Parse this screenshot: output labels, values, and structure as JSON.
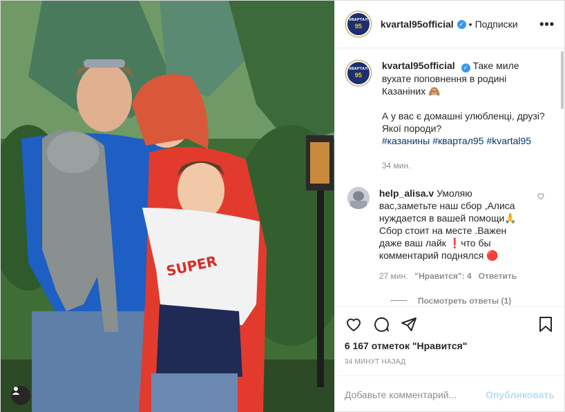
{
  "header": {
    "username": "kvartal95official",
    "verified_mark": "✓",
    "separator": "•",
    "follow_state": "Подписки",
    "more_label": "•••",
    "avatar_text_top": "КВАРТАЛ",
    "avatar_text_num": "95"
  },
  "caption": {
    "username": "kvartal95official",
    "text_line1": "Таке миле вухате поповнення в родині Казаніних",
    "emoji": "🙈",
    "text_line2": "А у вас є домашні улюбленці, друзі? Якої породи?",
    "hashtags": [
      "#казанины",
      "#квартал95",
      "#kvartal95"
    ],
    "time": "34 мин."
  },
  "comment": {
    "username": "help_alisa.v",
    "text": "Умоляю вас,заметьте наш сбор ,Алиса нуждается в вашей помощи🙏 Сбор стоит на месте .Важен даже ваш лайк ❗что бы комментарий поднялся 🔴",
    "time": "27 мин.",
    "likes": "\"Нравится\": 4",
    "reply": "Ответить",
    "view_replies": "Посмотреть ответы (1)"
  },
  "actions": {
    "likes_count": "6 167 отметок \"Нравится\"",
    "time_ago": "34 минут назад"
  },
  "add_comment": {
    "placeholder": "Добавьте комментарий...",
    "publish": "Опубликовать"
  },
  "colors": {
    "link": "#00376b",
    "verified": "#3897f0",
    "muted": "#8e8e8e",
    "publish_disabled": "#b2dffc"
  }
}
